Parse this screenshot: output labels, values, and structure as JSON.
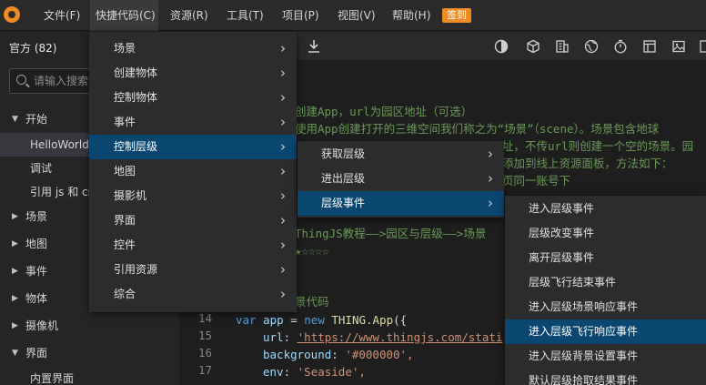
{
  "menubar": {
    "items": [
      "文件(F)",
      "快捷代码(C)",
      "资源(R)",
      "工具(T)",
      "项目(P)",
      "视图(V)",
      "帮助(H)"
    ],
    "signin": "签到"
  },
  "sidebar": {
    "title": "官方 (82)",
    "search_placeholder": "请输入搜索",
    "tree": [
      {
        "label": "开始",
        "arrow": "▼"
      },
      {
        "label": "HelloWorld",
        "arrow": ""
      },
      {
        "label": "调试",
        "arrow": ""
      },
      {
        "label": "引用 js 和 css",
        "arrow": ""
      },
      {
        "label": "场景",
        "arrow": "▶"
      },
      {
        "label": "地图",
        "arrow": "▶"
      },
      {
        "label": "事件",
        "arrow": "▶"
      },
      {
        "label": "物体",
        "arrow": "▶"
      },
      {
        "label": "摄像机",
        "arrow": "▶"
      },
      {
        "label": "界面",
        "arrow": "▼"
      },
      {
        "label": "内置界面",
        "arrow": ""
      }
    ]
  },
  "toolbar": {
    "icons": [
      "download-icon",
      "contrast-icon",
      "cube-icon",
      "building-icon",
      "globe-icon",
      "timer-icon",
      "layout-icon",
      "image-icon",
      "frame-icon"
    ]
  },
  "editor": {
    "comments": [
      "创建App，url为园区地址（可选）",
      "使用App创建打开的三维空间我们称之为“场景”（scene）。场景包含地球",
      "址，不传url则创建一个空的场景。园",
      "添加到线上资源面板，方法如下：",
      "页同一账号下"
    ],
    "line_comment_tutorial": "ThingJS教程——>园区与层级——>场景",
    "line_comment_stars": "★☆☆☆☆",
    "line_comment_scene_code": "景代码",
    "lines": [
      {
        "num": "14",
        "kw": "var",
        "id": "app",
        "op": " = ",
        "new": "new",
        "cls": "THING.App",
        "rest": "({"
      },
      {
        "num": "15",
        "key": "url",
        "value": "'https://www.thingjs.com/stati"
      },
      {
        "num": "16",
        "key": "background",
        "value": "'#000000',"
      },
      {
        "num": "17",
        "key": "env",
        "value": "'Seaside',"
      }
    ]
  },
  "menu_level1": {
    "items": [
      "场景",
      "创建物体",
      "控制物体",
      "事件",
      "控制层级",
      "地图",
      "摄影机",
      "界面",
      "控件",
      "引用资源",
      "综合"
    ],
    "active_index": 4
  },
  "menu_level2": {
    "items": [
      "获取层级",
      "进出层级",
      "层级事件"
    ],
    "active_index": 2
  },
  "menu_level3": {
    "items": [
      "进入层级事件",
      "层级改变事件",
      "离开层级事件",
      "层级飞行结束事件",
      "进入层级场景响应事件",
      "进入层级飞行响应事件",
      "进入层级背景设置事件",
      "默认层级拾取结果事件"
    ],
    "active_index": 5
  },
  "colors": {
    "accent": "#f08a24",
    "menu_active": "#094771"
  }
}
